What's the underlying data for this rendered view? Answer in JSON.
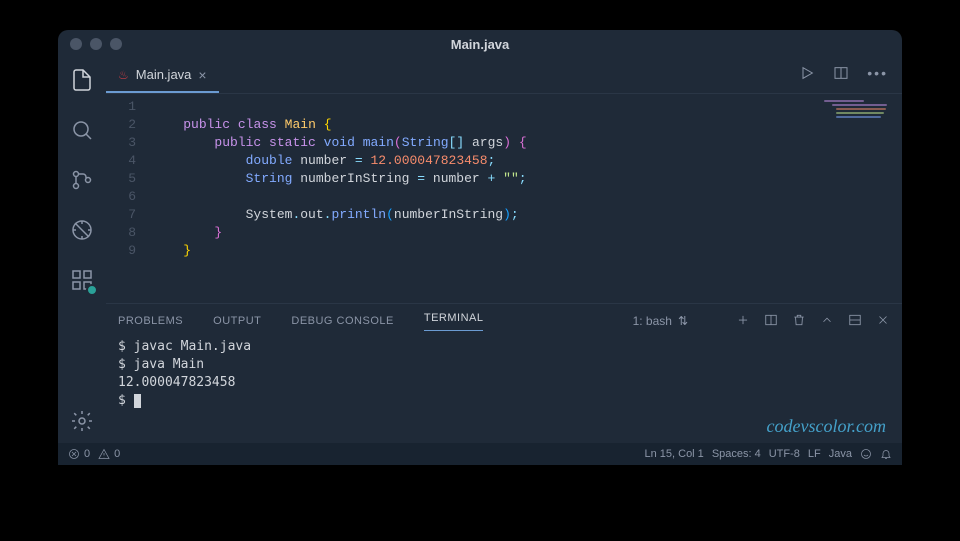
{
  "title": "Main.java",
  "tab": {
    "name": "Main.java"
  },
  "code": {
    "lines": [
      "1",
      "2",
      "3",
      "4",
      "5",
      "6",
      "7",
      "8",
      "9"
    ],
    "l2": {
      "kw1": "public",
      "kw2": "class",
      "cls": "Main"
    },
    "l3": {
      "kw1": "public",
      "kw2": "static",
      "type": "void",
      "fn": "main",
      "argtype": "String",
      "argname": "args"
    },
    "l4": {
      "type": "double",
      "var": "number",
      "val": "12.000047823458"
    },
    "l5": {
      "type": "String",
      "var": "numberInString",
      "src": "number",
      "str": "\"\""
    },
    "l7": {
      "obj": "System",
      "prop": "out",
      "fn": "println",
      "arg": "numberInString"
    }
  },
  "panel": {
    "tabs": {
      "problems": "PROBLEMS",
      "output": "OUTPUT",
      "debug": "DEBUG CONSOLE",
      "terminal": "TERMINAL"
    },
    "bash": "1: bash",
    "terminal": {
      "l1": "$ javac Main.java",
      "l2": "$ java Main",
      "l3": "12.000047823458",
      "l4": "$ "
    }
  },
  "watermark": "codevscolor.com",
  "status": {
    "errors": "0",
    "warnings": "0",
    "pos": "Ln 15, Col 1",
    "spaces": "Spaces: 4",
    "encoding": "UTF-8",
    "eol": "LF",
    "lang": "Java"
  }
}
